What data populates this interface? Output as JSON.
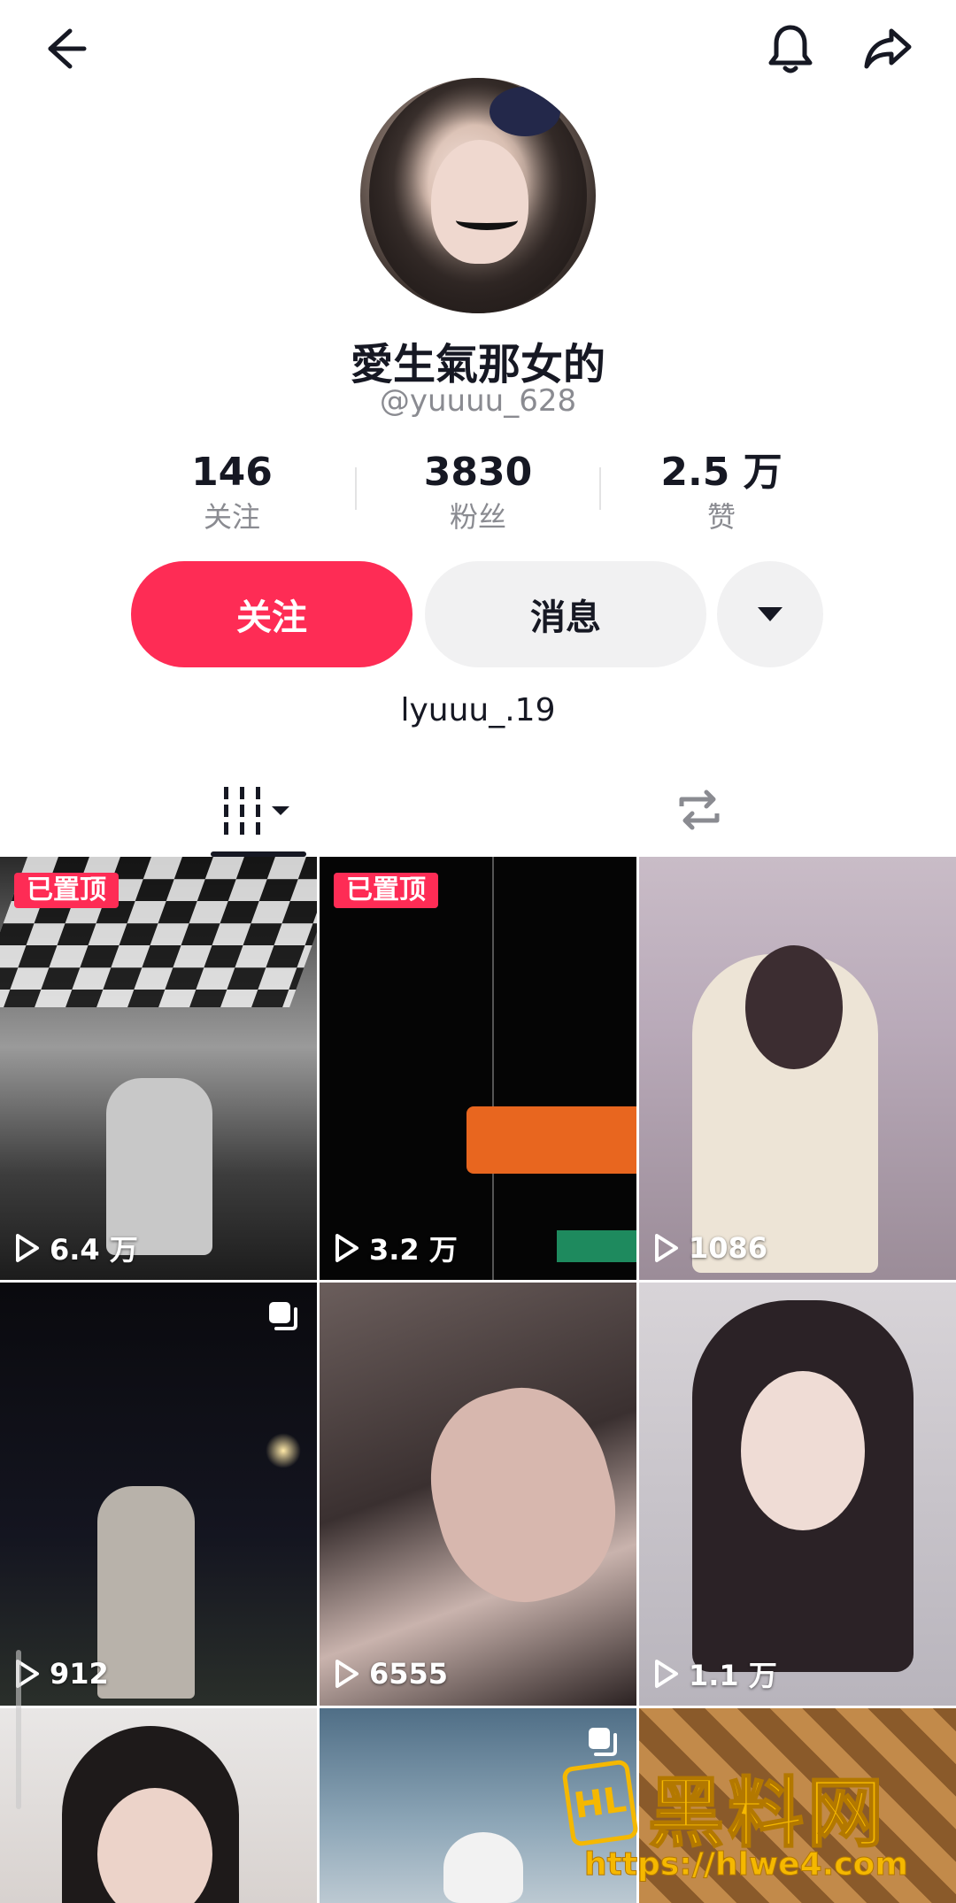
{
  "header": {
    "back_icon": "arrow-left-icon",
    "bell_icon": "bell-icon",
    "share_icon": "share-arrow-icon"
  },
  "profile": {
    "display_name": "愛生氣那女的",
    "handle": "@yuuuu_628",
    "bio": "lyuuu_.19"
  },
  "stats": [
    {
      "value": "146",
      "label": "关注"
    },
    {
      "value": "3830",
      "label": "粉丝"
    },
    {
      "value": "2.5 万",
      "label": "赞"
    }
  ],
  "actions": {
    "follow_label": "关注",
    "message_label": "消息",
    "more_icon": "caret-down-icon"
  },
  "tabs": [
    {
      "icon": "videos-grid-icon",
      "selected": true
    },
    {
      "icon": "repost-icon",
      "selected": false
    }
  ],
  "videos": [
    {
      "pinned_label": "已置顶",
      "views": "6.4 万"
    },
    {
      "pinned_label": "已置顶",
      "views": "3.2 万"
    },
    {
      "views": "1086"
    },
    {
      "views": "912",
      "multi_image": true
    },
    {
      "views": "6555"
    },
    {
      "views": "1.1 万"
    },
    {},
    {
      "multi_image": true
    },
    {}
  ],
  "watermark": {
    "logo_text": "HL",
    "title": "黑料网",
    "url": "https://hlwe4.com"
  },
  "colors": {
    "accent": "#fe2c55",
    "secondary_button": "#f1f1f2",
    "muted_text": "#8a8b91",
    "watermark": "#f5b800"
  }
}
